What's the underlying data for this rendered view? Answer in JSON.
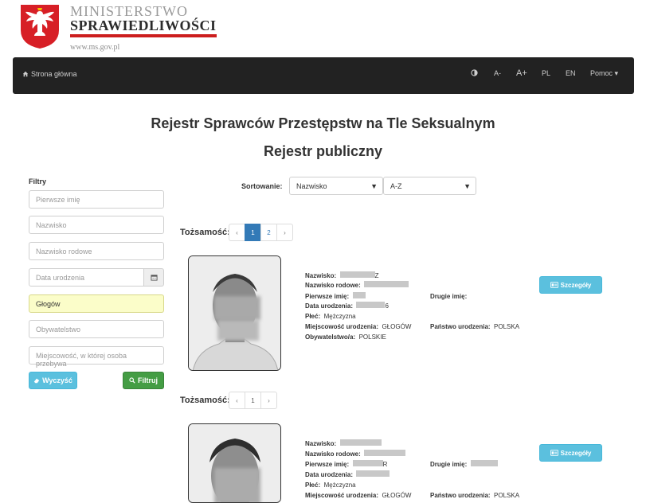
{
  "header": {
    "logo_line1": "MINISTERSTWO",
    "logo_line2": "SPRAWIEDLIWOŚCI",
    "logo_url": "www.ms.gov.pl"
  },
  "nav": {
    "home": "Strona główna",
    "contrast_icon": "contrast-icon",
    "font_smaller": "A-",
    "font_larger": "A+",
    "lang_pl": "PL",
    "lang_en": "EN",
    "help": "Pomoc"
  },
  "page": {
    "title": "Rejestr Sprawców Przestępstw na Tle Seksualnym",
    "subtitle": "Rejestr publiczny"
  },
  "filters": {
    "label": "Filtry",
    "first_name_placeholder": "Pierwsze imię",
    "surname_placeholder": "Nazwisko",
    "family_name_placeholder": "Nazwisko rodowe",
    "birth_date_placeholder": "Data urodzenia",
    "city_value": "Głogów",
    "citizenship_placeholder": "Obywatelstwo",
    "residence_placeholder": "Miejscowość, w której osoba przebywa",
    "clear_label": "Wyczyść",
    "filter_label": "Filtruj"
  },
  "sort": {
    "label": "Sortowanie:",
    "field_value": "Nazwisko",
    "order_value": "A-Z"
  },
  "records": [
    {
      "ident_label": "Tożsamość:",
      "pages": [
        "‹",
        "1",
        "2",
        "›"
      ],
      "active_page": "1",
      "surname_label": "Nazwisko:",
      "surname_suffix": "Z",
      "family_name_label": "Nazwisko rodowe:",
      "first_name_label": "Pierwsze imię:",
      "second_name_label": "Drugie imię:",
      "birth_date_label": "Data urodzenia:",
      "birth_date_suffix": "6",
      "sex_label": "Płeć:",
      "sex_value": "Mężczyzna",
      "birth_place_label": "Miejscowość urodzenia:",
      "birth_place_value": "GŁOGÓW",
      "birth_country_label": "Państwo urodzenia:",
      "birth_country_value": "POLSKA",
      "citizenship_label": "Obywatelstwo/a:",
      "citizenship_value": "POLSKIE",
      "details_label": "Szczegóły"
    },
    {
      "ident_label": "Tożsamość:",
      "pages": [
        "‹",
        "1",
        "›"
      ],
      "surname_label": "Nazwisko:",
      "family_name_label": "Nazwisko rodowe:",
      "first_name_label": "Pierwsze imię:",
      "first_name_partial": "R",
      "second_name_label": "Drugie imię:",
      "birth_date_label": "Data urodzenia:",
      "sex_label": "Płeć:",
      "sex_value": "Mężczyzna",
      "birth_place_label": "Miejscowość urodzenia:",
      "birth_place_value": "GŁOGÓW",
      "birth_country_label": "Państwo urodzenia:",
      "birth_country_value": "POLSKA",
      "details_label": "Szczegóły"
    }
  ],
  "colors": {
    "navbar": "#222222",
    "primary": "#337ab7",
    "info": "#5bc0de",
    "success": "#449d44",
    "brand_red": "#cc1e1e"
  }
}
